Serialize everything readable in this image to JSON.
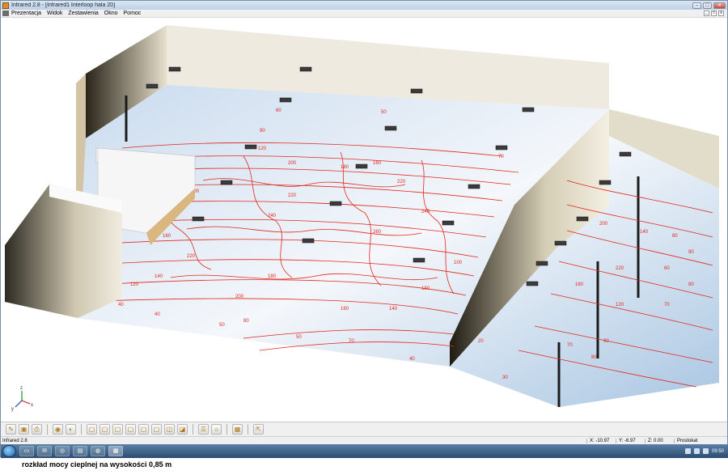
{
  "window": {
    "title": "Infrared 2.8 - [Infrared1 Interloop hala 20]"
  },
  "menu": {
    "items": [
      "Prezentacja",
      "Widok",
      "Zestawienia",
      "Okno",
      "Pomoc"
    ]
  },
  "viewport": {
    "axis": {
      "x": "x",
      "y": "y",
      "z": "z"
    },
    "contour_labels": [
      "20",
      "30",
      "40",
      "50",
      "60",
      "70",
      "80",
      "90",
      "100",
      "120",
      "140",
      "160",
      "180",
      "200",
      "220",
      "240",
      "260"
    ]
  },
  "toolbar": {
    "buttons": [
      "edit-icon",
      "save-icon",
      "print-icon",
      "palette-icon",
      "color-icon",
      "view-front-icon",
      "view-back-icon",
      "view-left-icon",
      "view-right-icon",
      "view-top-icon",
      "view-bottom-icon",
      "view-iso-icon",
      "view-persp-icon",
      "layers-icon",
      "render-icon",
      "grid-icon",
      "export-icon"
    ]
  },
  "status": {
    "text": "Infrared 2.8",
    "x": "X: -10.97",
    "y": "Y: -6.97",
    "z": "Z: 0.00",
    "mode": "Prostokat"
  },
  "taskbar": {
    "clock": "09:50"
  },
  "caption": "rozkład mocy cieplnej na wysokości 0,85 m"
}
